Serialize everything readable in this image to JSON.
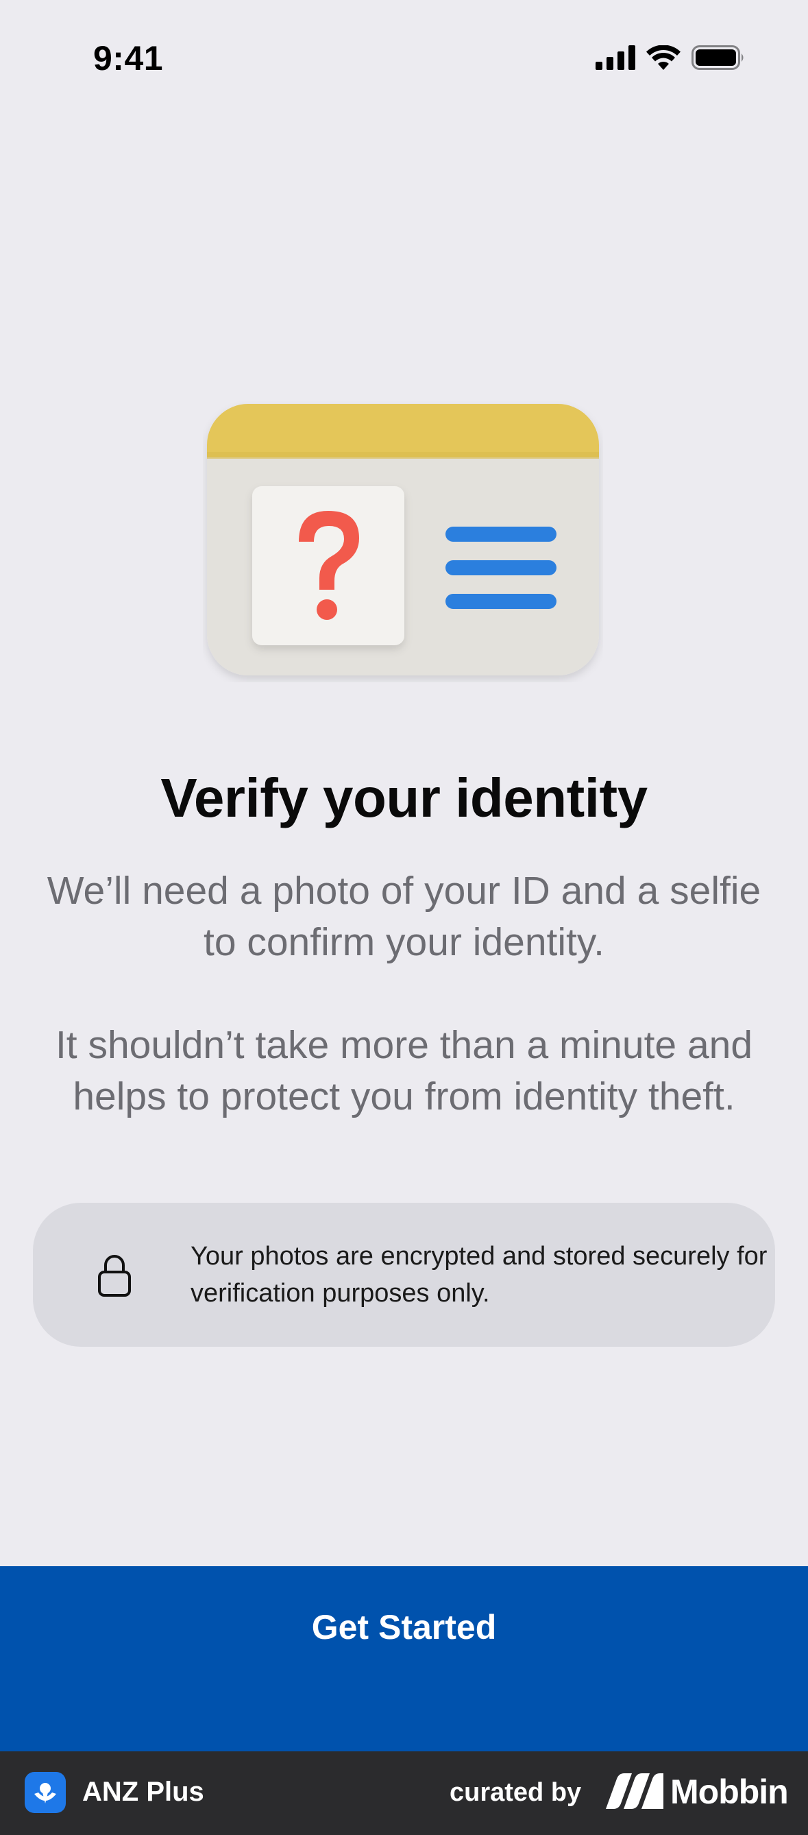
{
  "status_bar": {
    "time": "9:41",
    "icons": [
      "cellular-signal-icon",
      "wifi-icon",
      "battery-icon"
    ]
  },
  "illustration": {
    "icon": "id-card-question-icon",
    "colors": {
      "card": "#E3E1DC",
      "header": "#E4C659",
      "question": "#F25A4C",
      "lines": "#2B7FDE"
    }
  },
  "main": {
    "title": "Verify your identity",
    "description_1": "We’ll need a photo of your ID and a selfie to confirm your identity.",
    "description_2": "It shouldn’t take more than a minute and helps to protect you from identity theft."
  },
  "info_box": {
    "icon": "lock-icon",
    "text": "Your photos are encrypted and stored securely for verification purposes only."
  },
  "cta": {
    "label": "Get Started",
    "color": "#0052AD"
  },
  "footer": {
    "app_name": "ANZ Plus",
    "curated_by": "curated by",
    "brand": "Mobbin"
  }
}
